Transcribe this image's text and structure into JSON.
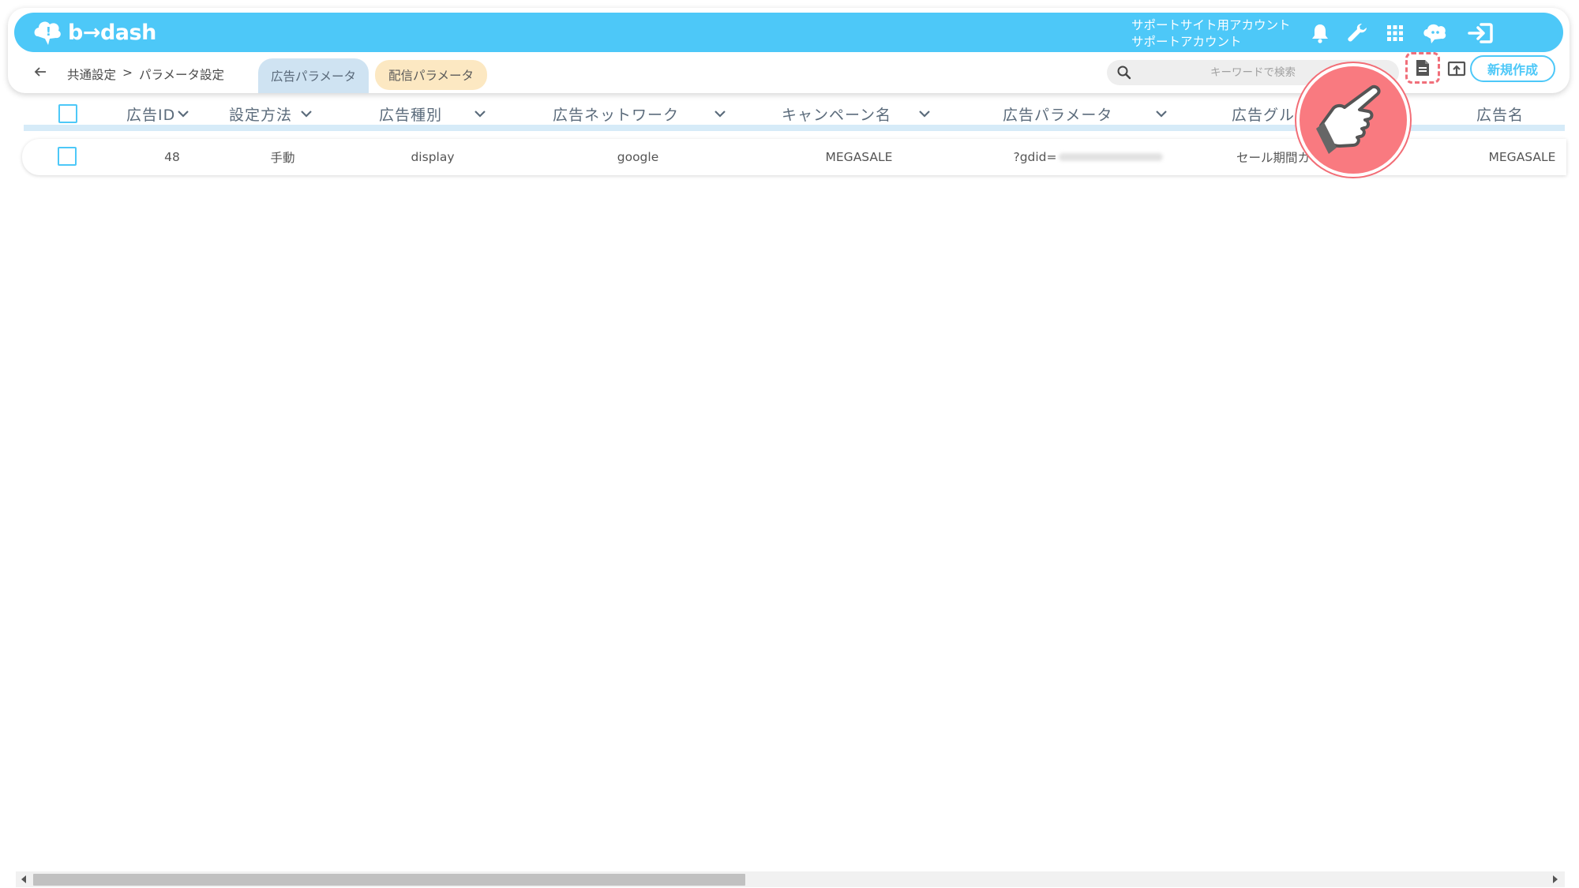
{
  "brand": {
    "logo_text": "b→dash",
    "primary_color": "#4dc8f8"
  },
  "header": {
    "account_line1": "サポートサイト用アカウント",
    "account_line2": "サポートアカウント",
    "icons": [
      "bell-icon",
      "wrench-icon",
      "grid-icon",
      "assistant-icon",
      "logout-icon"
    ]
  },
  "breadcrumb": {
    "parent": "共通設定",
    "separator": ">",
    "current": "パラメータ設定"
  },
  "tabs": {
    "ad_params": "広告パラメータ",
    "dist_params": "配信パラメータ"
  },
  "search": {
    "placeholder": "キーワードで検索"
  },
  "toolbar": {
    "new_label": "新規作成"
  },
  "table": {
    "columns": [
      "広告ID",
      "設定方法",
      "広告種別",
      "広告ネットワーク",
      "キャンペーン名",
      "広告パラメータ",
      "広告グル",
      "広告名"
    ],
    "rows": [
      {
        "id": "48",
        "method": "手動",
        "type": "display",
        "network": "google",
        "campaign": "MEGASALE",
        "param": "?gdid=",
        "group": "セール期間カウン",
        "name": "MEGASALE"
      }
    ]
  }
}
